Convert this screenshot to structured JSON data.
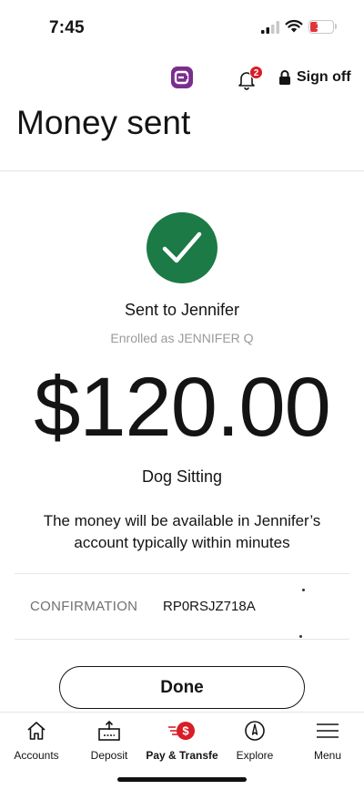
{
  "status_bar": {
    "time": "7:45",
    "battery": "15"
  },
  "header": {
    "notification_count": "2",
    "sign_off_label": "Sign off",
    "title": "Money sent"
  },
  "confirmation": {
    "recipient_line": "Sent to Jennifer",
    "enrolled_line": "Enrolled as JENNIFER Q",
    "amount": "$120.00",
    "memo": "Dog Sitting",
    "availability_text": "The money will be available in Jennifer’s account typically within minutes",
    "confirmation_label": "CONFIRMATION",
    "confirmation_number": "RP0RSJZ718A",
    "done_label": "Done"
  },
  "tabbar": {
    "items": [
      {
        "label": "Accounts",
        "icon": "home-icon"
      },
      {
        "label": "Deposit",
        "icon": "deposit-icon"
      },
      {
        "label": "Pay & Transfe",
        "icon": "pay-transfer-icon",
        "active": true
      },
      {
        "label": "Explore",
        "icon": "compass-icon"
      },
      {
        "label": "Menu",
        "icon": "hamburger-menu-icon"
      }
    ]
  },
  "colors": {
    "success_green": "#1b7a45",
    "brand_red": "#d71e28",
    "assistant_purple": "#7b2d8e"
  }
}
